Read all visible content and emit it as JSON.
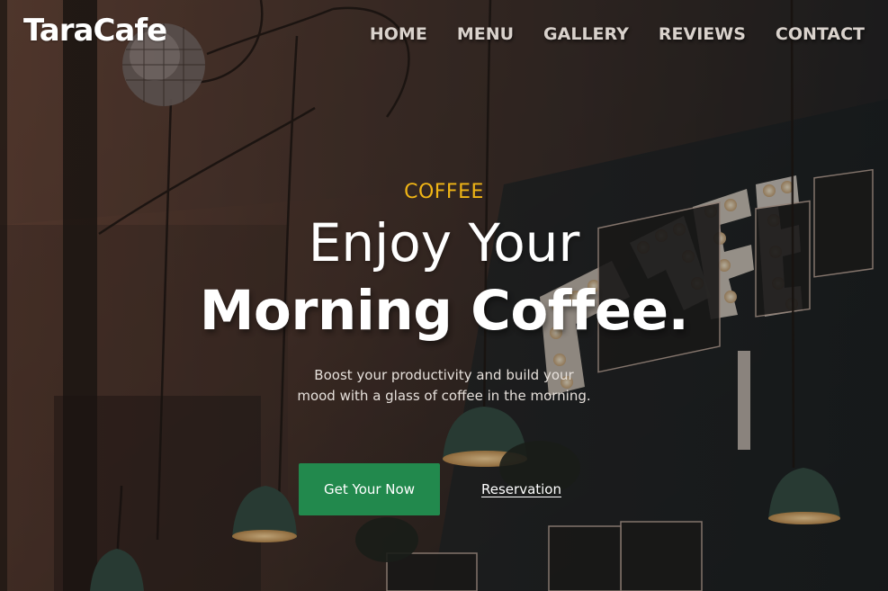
{
  "brand": {
    "logo_text": "TaraCafe"
  },
  "nav": {
    "items": [
      {
        "label": "HOME"
      },
      {
        "label": "MENU"
      },
      {
        "label": "GALLERY"
      },
      {
        "label": "REVIEWS"
      },
      {
        "label": "CONTACT"
      }
    ]
  },
  "hero": {
    "eyebrow": "COFFEE",
    "headline_line1": "Enjoy Your",
    "headline_line2": "Morning Coffee.",
    "subtext_line1": "Boost your productivity and build your",
    "subtext_line2": "mood with a glass of coffee in the morning.",
    "primary_button": "Get Your Now",
    "secondary_link": "Reservation",
    "background_sign": "CAFE"
  },
  "colors": {
    "accent": "#f0b516",
    "button": "#22894d",
    "text": "#ffffff"
  }
}
